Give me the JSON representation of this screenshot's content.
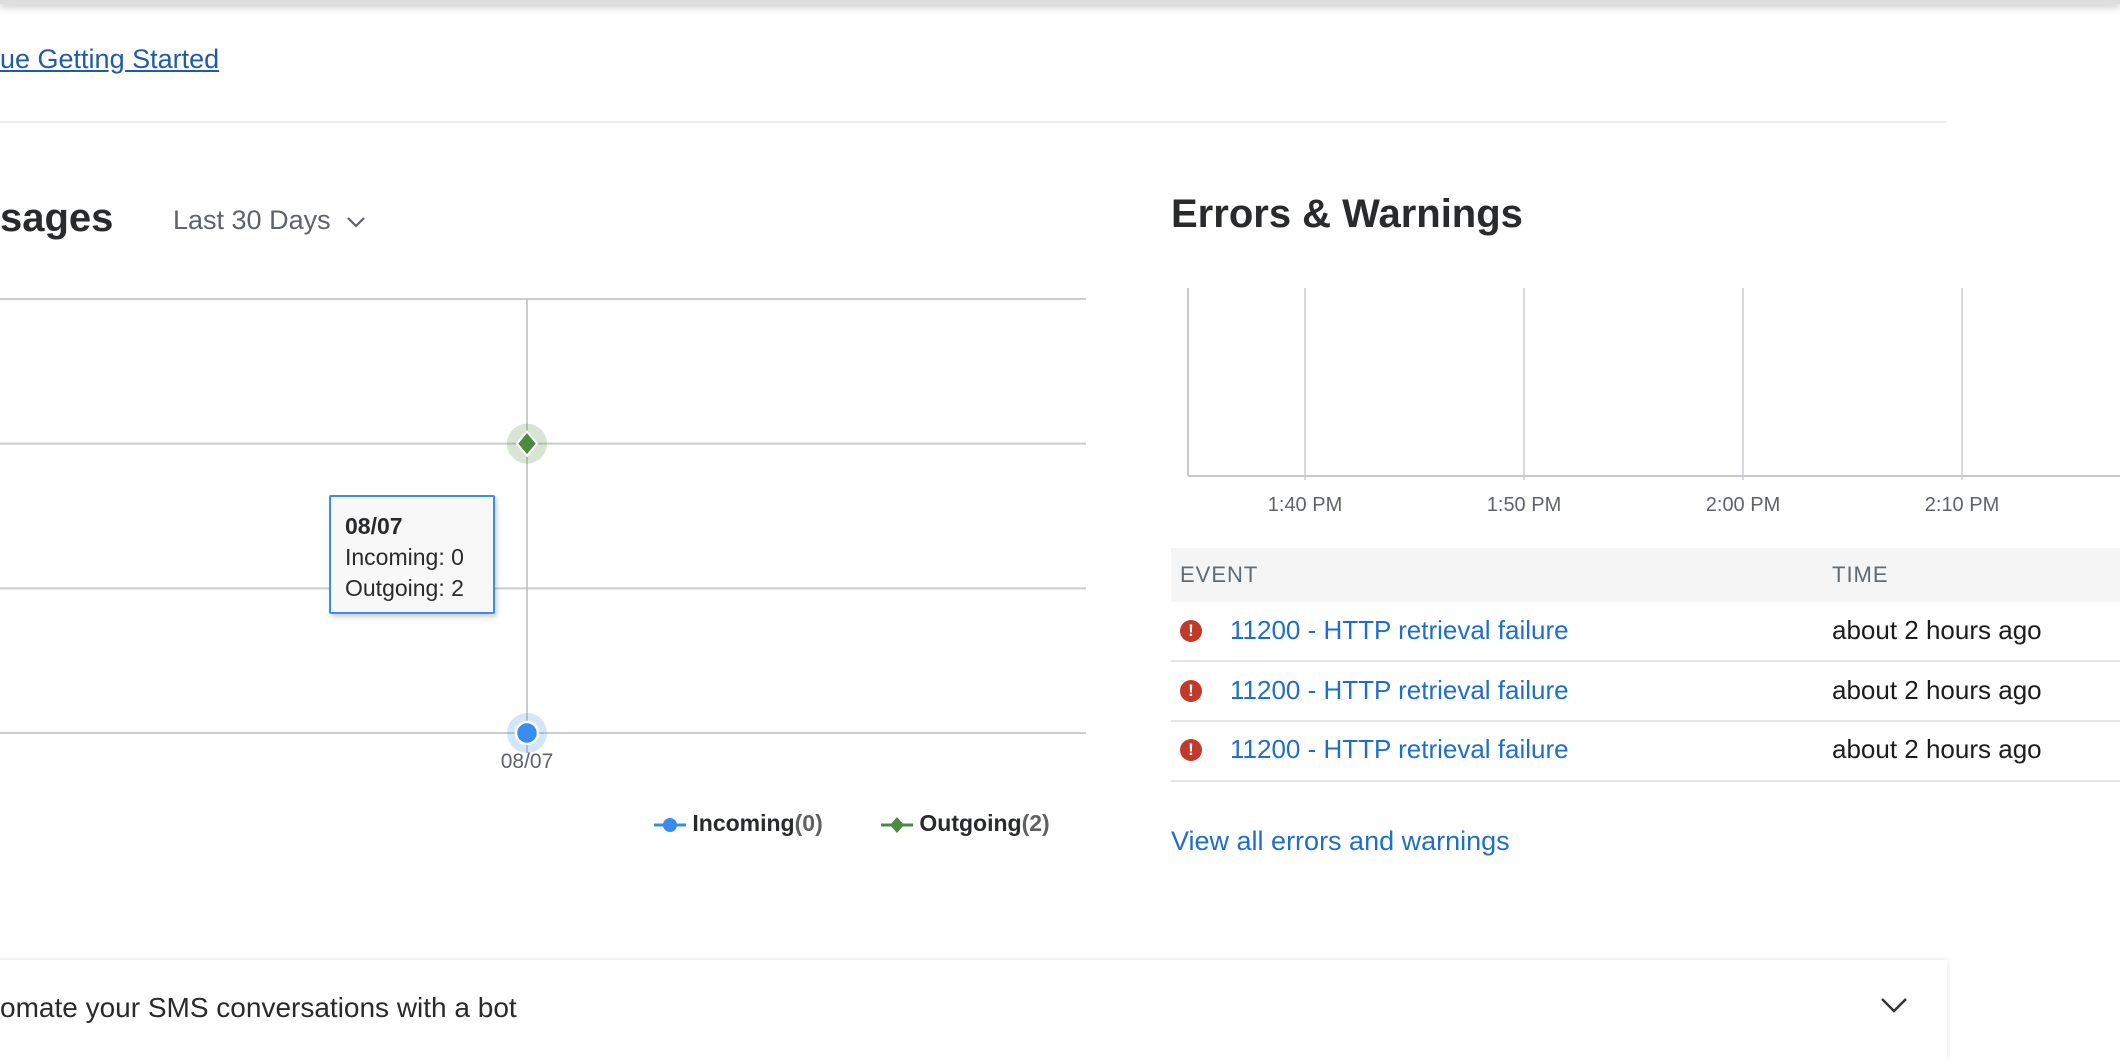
{
  "header": {
    "getting_started_link": "ue Getting Started"
  },
  "messages": {
    "title": "sages",
    "range_selector": "Last 30 Days",
    "tooltip": {
      "date": "08/07",
      "incoming": "Incoming: 0",
      "outgoing": "Outgoing: 2"
    },
    "legend": [
      {
        "label": "Incoming",
        "count": "(0)",
        "color": "#3a8cf0"
      },
      {
        "label": "Outgoing",
        "count": "(2)",
        "color": "#4d8a3e"
      }
    ]
  },
  "chart_data": {
    "type": "line",
    "categories": [
      "08/07"
    ],
    "series": [
      {
        "name": "Incoming",
        "values": [
          0
        ],
        "color": "#3a8cf0",
        "marker": "circle"
      },
      {
        "name": "Outgoing",
        "values": [
          2
        ],
        "color": "#4d8a3e",
        "marker": "diamond"
      }
    ],
    "ylim": [
      0,
      3
    ],
    "grid": true,
    "legend": "bottom-right"
  },
  "errors": {
    "title": "Errors & Warnings",
    "time_ticks": [
      "1:40 PM",
      "1:50 PM",
      "2:00 PM",
      "2:10 PM"
    ],
    "table": {
      "columns": [
        "EVENT",
        "TIME"
      ],
      "rows": [
        {
          "event": "11200 - HTTP retrieval failure",
          "time": "about 2 hours ago"
        },
        {
          "event": "11200 - HTTP retrieval failure",
          "time": "about 2 hours ago"
        },
        {
          "event": "11200 - HTTP retrieval failure",
          "time": "about 2 hours ago"
        }
      ]
    },
    "error_icon": "exclamation-circle-icon",
    "error_color": "#c0392b",
    "view_all": "View all errors and warnings"
  },
  "card": {
    "text": "omate your SMS conversations with a bot"
  }
}
